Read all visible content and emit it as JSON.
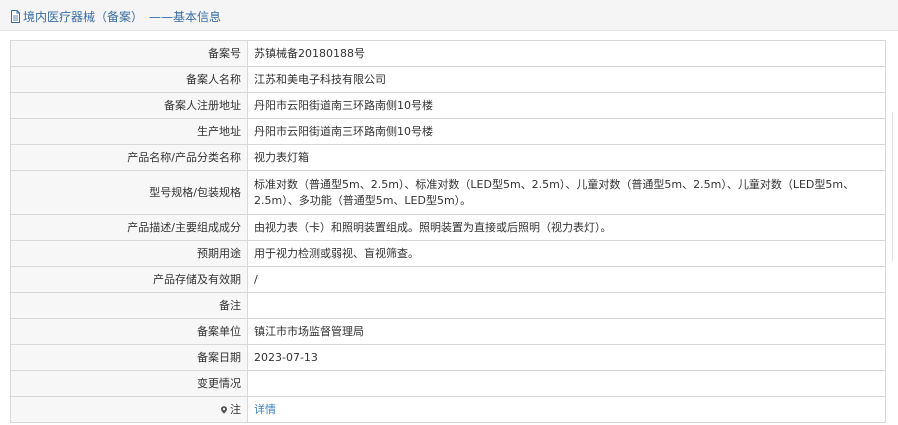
{
  "header": {
    "title_prefix": "境内医疗器械（备案）",
    "title_sep": "——",
    "title_suffix": "基本信息"
  },
  "rows": [
    {
      "label": "备案号",
      "value": "苏镇械备20180188号"
    },
    {
      "label": "备案人名称",
      "value": "江苏和美电子科技有限公司"
    },
    {
      "label": "备案人注册地址",
      "value": "丹阳市云阳街道南三环路南侧10号楼"
    },
    {
      "label": "生产地址",
      "value": "丹阳市云阳街道南三环路南侧10号楼"
    },
    {
      "label": "产品名称/产品分类名称",
      "value": "视力表灯箱"
    },
    {
      "label": "型号规格/包装规格",
      "value": "标准对数（普通型5m、2.5m）、标准对数（LED型5m、2.5m）、儿童对数（普通型5m、2.5m）、儿童对数（LED型5m、2.5m）、多功能（普通型5m、LED型5m）。"
    },
    {
      "label": "产品描述/主要组成成分",
      "value": "由视力表（卡）和照明装置组成。照明装置为直接或后照明（视力表灯）。"
    },
    {
      "label": "预期用途",
      "value": "用于视力检测或弱视、盲视筛查。"
    },
    {
      "label": "产品存储及有效期",
      "value": "/"
    },
    {
      "label": "备注",
      "value": ""
    },
    {
      "label": "备案单位",
      "value": "镇江市市场监督管理局"
    },
    {
      "label": "备案日期",
      "value": "2023-07-13"
    },
    {
      "label": "变更情况",
      "value": ""
    },
    {
      "label": "注",
      "value": "详情"
    }
  ],
  "icons": {
    "header": "document-icon",
    "note": "location-pin-icon"
  },
  "colors": {
    "link": "#3a7fc1",
    "header_text": "#3a6ea5",
    "label_bg": "#f7f7f7"
  }
}
